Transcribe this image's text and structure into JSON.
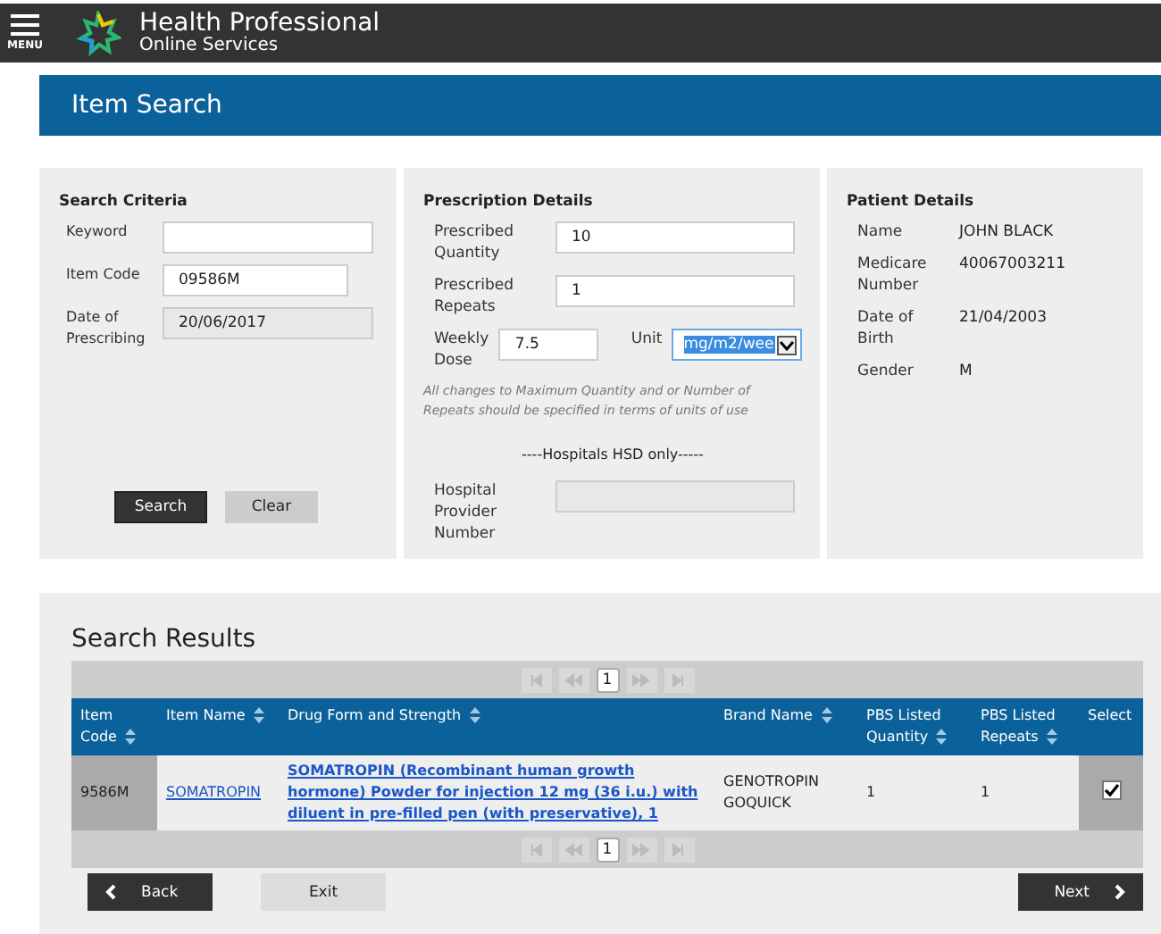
{
  "header": {
    "menu_label": "MENU",
    "title": "Health Professional",
    "subtitle": "Online Services"
  },
  "page_title": "Item Search",
  "search_criteria": {
    "title": "Search Criteria",
    "fields": [
      {
        "label": "Keyword",
        "disabled": false
      },
      {
        "label": "Item Code",
        "value": "09586M",
        "disabled": false
      },
      {
        "label": "Date of Prescribing",
        "value": "20/06/2017",
        "disabled": true
      }
    ],
    "buttons": [
      {
        "label": "Search",
        "kind": "primary"
      },
      {
        "label": "Clear",
        "kind": "secondary"
      }
    ]
  },
  "prescription": {
    "title": "Prescription Details",
    "fields": [
      {
        "label": "Prescribed Quantity",
        "value": "10"
      },
      {
        "label": "Prescribed Repeats",
        "value": "1"
      }
    ],
    "weekly_dose": {
      "label": "Weekly Dose",
      "value": "7.5"
    },
    "unit": {
      "label": "Unit",
      "value": "mg/m2/wee",
      "focused": true
    },
    "note": "All changes to Maximum Quantity and or Number of Repeats should be specified in terms of units of use",
    "hsd_heading": "----Hospitals HSD only-----",
    "hospital_field": {
      "label": "Hospital Provider Number",
      "disabled": true
    }
  },
  "patient": {
    "title": "Patient Details",
    "rows": [
      {
        "label": "Name",
        "value": "JOHN BLACK"
      },
      {
        "label": "Medicare Number",
        "value": "40067003211"
      },
      {
        "label": "Date of Birth",
        "value": "21/04/2003"
      },
      {
        "label": "Gender",
        "value": "M"
      }
    ]
  },
  "results": {
    "title": "Search Results",
    "pager_top": {
      "pages": [
        {
          "label": "1",
          "selected": true
        }
      ]
    },
    "columns": [
      {
        "label": "Item Code",
        "sortable": true
      },
      {
        "label": "Item Name",
        "sortable": true
      },
      {
        "label": "Drug Form and Strength",
        "sortable": true
      },
      {
        "label": "Brand Name",
        "sortable": true
      },
      {
        "label": "PBS Listed Quantity",
        "sortable": true
      },
      {
        "label": "PBS Listed Repeats",
        "sortable": true
      },
      {
        "label": "Select",
        "sortable": false
      }
    ],
    "rows": [
      {
        "item_code": "9586M",
        "item_name": "SOMATROPIN",
        "drug_form": "SOMATROPIN (Recombinant human growth hormone) Powder for injection 12 mg (36 i.u.) with diluent in pre-filled pen (with preservative), 1",
        "brand_name": "GENOTROPIN GOQUICK",
        "quantity": "1",
        "repeats": "1",
        "checked": true
      }
    ],
    "pager_bottom": {
      "pages": [
        {
          "label": "1",
          "selected": true
        }
      ]
    }
  },
  "nav": [
    {
      "label": "Back",
      "kind": "back"
    },
    {
      "label": "Exit",
      "kind": "plain"
    },
    {
      "label": "Next",
      "kind": "next"
    }
  ]
}
